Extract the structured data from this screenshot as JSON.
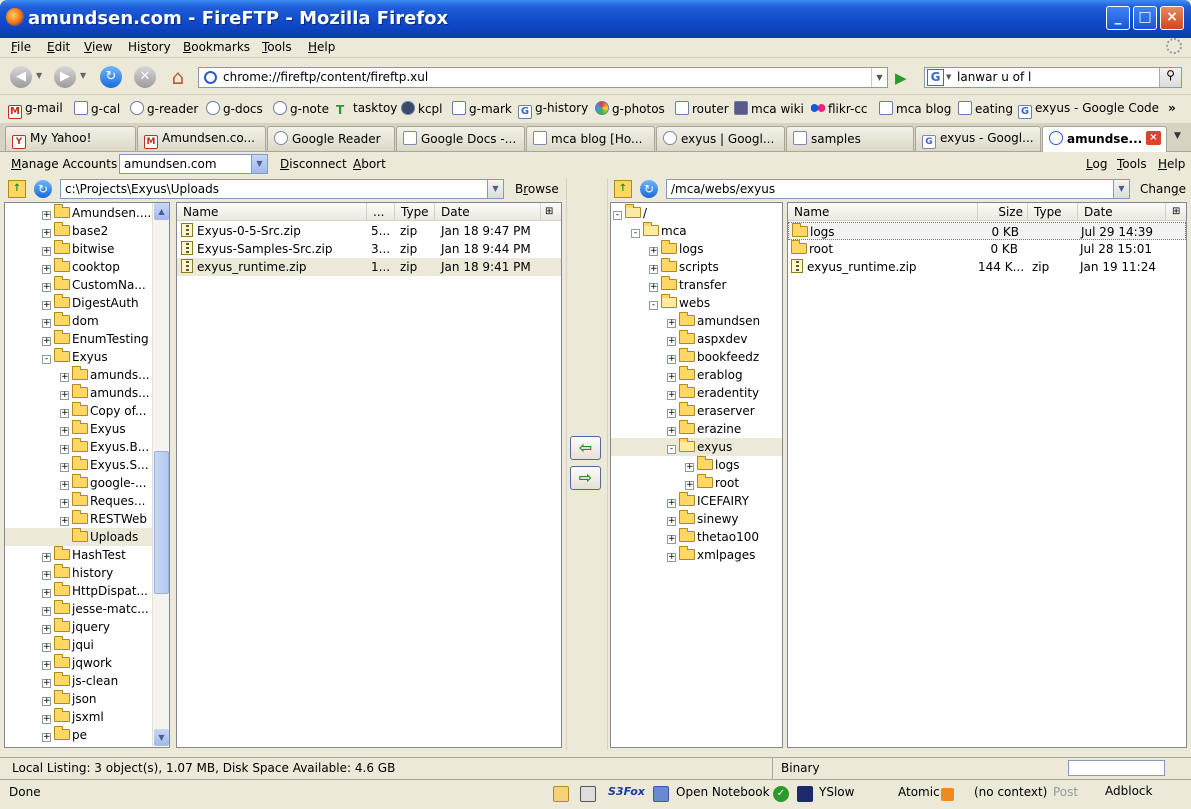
{
  "window": {
    "title": "amundsen.com - FireFTP - Mozilla Firefox"
  },
  "menubar": [
    "{F}ile",
    "{E}dit",
    "{V}iew",
    "Hi{s}tory",
    "{B}ookmarks",
    "{T}ools",
    "{H}elp"
  ],
  "nav": {
    "url": "chrome://fireftp/content/fireftp.xul",
    "search": "lanwar u of l"
  },
  "bookmarks": [
    "g-mail",
    "g-cal",
    "g-reader",
    "g-docs",
    "g-note",
    "tasktoy",
    "kcpl",
    "g-mark",
    "g-history",
    "g-photos",
    "router",
    "mca wiki",
    "flikr-cc",
    "mca blog",
    "eating",
    "exyus - Google Code"
  ],
  "tabs": [
    "My Yahoo!",
    "Amundsen.co...",
    "Google Reader",
    "Google Docs -...",
    "mca blog [Ho...",
    "exyus | Googl...",
    "samples",
    "exyus - Googl...",
    "amundse..."
  ],
  "ftp": {
    "manage": "{M}anage Accounts",
    "account": "amundsen.com",
    "disconnect": "{D}isconnect",
    "abort": "{A}bort",
    "log": "{L}og",
    "tools": "{T}ools",
    "help": "{H}elp",
    "local_path": "c:\\Projects\\Exyus\\Uploads",
    "browse": "B{r}owse",
    "remote_path": "/mca/webs/exyus",
    "change": "Chan{g}e"
  },
  "local_tree": [
    {
      "label": "Amundsen....",
      "level": 0,
      "exp": "+"
    },
    {
      "label": "base2",
      "level": 0,
      "exp": "+"
    },
    {
      "label": "bitwise",
      "level": 0,
      "exp": "+"
    },
    {
      "label": "cooktop",
      "level": 0,
      "exp": "+"
    },
    {
      "label": "CustomNa...",
      "level": 0,
      "exp": "+"
    },
    {
      "label": "DigestAuth",
      "level": 0,
      "exp": "+"
    },
    {
      "label": "dom",
      "level": 0,
      "exp": "+"
    },
    {
      "label": "EnumTesting",
      "level": 0,
      "exp": "+"
    },
    {
      "label": "Exyus",
      "level": 0,
      "exp": "-"
    },
    {
      "label": "amunds...",
      "level": 1,
      "exp": "+"
    },
    {
      "label": "amunds...",
      "level": 1,
      "exp": "+"
    },
    {
      "label": "Copy of...",
      "level": 1,
      "exp": "+"
    },
    {
      "label": "Exyus",
      "level": 1,
      "exp": "+"
    },
    {
      "label": "Exyus.B...",
      "level": 1,
      "exp": "+"
    },
    {
      "label": "Exyus.S...",
      "level": 1,
      "exp": "+"
    },
    {
      "label": "google-...",
      "level": 1,
      "exp": "+"
    },
    {
      "label": "Reques...",
      "level": 1,
      "exp": "+"
    },
    {
      "label": "RESTWeb",
      "level": 1,
      "exp": "+"
    },
    {
      "label": "Uploads",
      "level": 1,
      "exp": "",
      "selected": true
    },
    {
      "label": "HashTest",
      "level": 0,
      "exp": "+"
    },
    {
      "label": "history",
      "level": 0,
      "exp": "+"
    },
    {
      "label": "HttpDispat...",
      "level": 0,
      "exp": "+"
    },
    {
      "label": "jesse-matc...",
      "level": 0,
      "exp": "+"
    },
    {
      "label": "jquery",
      "level": 0,
      "exp": "+"
    },
    {
      "label": "jqui",
      "level": 0,
      "exp": "+"
    },
    {
      "label": "jqwork",
      "level": 0,
      "exp": "+"
    },
    {
      "label": "js-clean",
      "level": 0,
      "exp": "+"
    },
    {
      "label": "json",
      "level": 0,
      "exp": "+"
    },
    {
      "label": "jsxml",
      "level": 0,
      "exp": "+"
    },
    {
      "label": "pe",
      "level": 0,
      "exp": "+"
    }
  ],
  "local_headers": [
    "Name",
    "...",
    "Type",
    "Date"
  ],
  "local_files": [
    {
      "name": "Exyus-0-5-Src.zip",
      "size": "5...",
      "type": "zip",
      "date": "Jan 18 9:47 PM"
    },
    {
      "name": "Exyus-Samples-Src.zip",
      "size": "3...",
      "type": "zip",
      "date": "Jan 18 9:44 PM"
    },
    {
      "name": "exyus_runtime.zip",
      "size": "1...",
      "type": "zip",
      "date": "Jan 18 9:41 PM",
      "selected": true
    }
  ],
  "remote_tree": [
    {
      "label": "/",
      "level": 0,
      "exp": "-"
    },
    {
      "label": "mca",
      "level": 1,
      "exp": "-"
    },
    {
      "label": "logs",
      "level": 2,
      "exp": "+"
    },
    {
      "label": "scripts",
      "level": 2,
      "exp": "+"
    },
    {
      "label": "transfer",
      "level": 2,
      "exp": "+"
    },
    {
      "label": "webs",
      "level": 2,
      "exp": "-"
    },
    {
      "label": "amundsen",
      "level": 3,
      "exp": "+"
    },
    {
      "label": "aspxdev",
      "level": 3,
      "exp": "+"
    },
    {
      "label": "bookfeedz",
      "level": 3,
      "exp": "+"
    },
    {
      "label": "erablog",
      "level": 3,
      "exp": "+"
    },
    {
      "label": "eradentity",
      "level": 3,
      "exp": "+"
    },
    {
      "label": "eraserver",
      "level": 3,
      "exp": "+"
    },
    {
      "label": "erazine",
      "level": 3,
      "exp": "+"
    },
    {
      "label": "exyus",
      "level": 3,
      "exp": "-",
      "selected": true
    },
    {
      "label": "logs",
      "level": 4,
      "exp": "+"
    },
    {
      "label": "root",
      "level": 4,
      "exp": "+"
    },
    {
      "label": "ICEFAIRY",
      "level": 3,
      "exp": "+"
    },
    {
      "label": "sinewy",
      "level": 3,
      "exp": "+"
    },
    {
      "label": "thetao100",
      "level": 3,
      "exp": "+"
    },
    {
      "label": "xmlpages",
      "level": 3,
      "exp": "+"
    }
  ],
  "remote_headers": [
    "Name",
    "Size",
    "Type",
    "Date"
  ],
  "remote_files": [
    {
      "name": "logs",
      "size": "0 KB",
      "type": "",
      "date": "Jul 29 14:39",
      "kind": "folder",
      "selected": true
    },
    {
      "name": "root",
      "size": "0 KB",
      "type": "",
      "date": "Jul 28 15:01",
      "kind": "folder"
    },
    {
      "name": "exyus_runtime.zip",
      "size": "144 K...",
      "type": "zip",
      "date": "Jan 19 11:24",
      "kind": "zip"
    }
  ],
  "status": {
    "listing": "Local Listing: 3 object(s), 1.07 MB, Disk Space Available: 4.6 GB",
    "mode": "Binary"
  },
  "ffstatus": {
    "done": "Done",
    "s3fox": "S3Fox",
    "notebook": "Open Notebook",
    "yslow": "YSlow",
    "atomic": "Atomic",
    "context": "(no context)",
    "post": "Post",
    "adblock": "Adblock"
  }
}
